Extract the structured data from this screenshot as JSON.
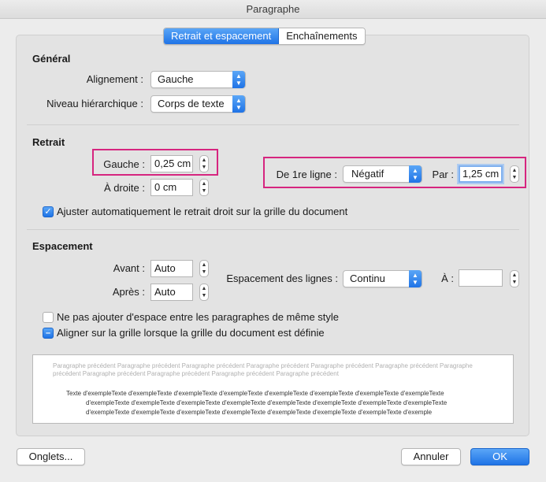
{
  "window": {
    "title": "Paragraphe"
  },
  "tabs": [
    {
      "label": "Retrait et espacement",
      "active": true
    },
    {
      "label": "Enchaînements",
      "active": false
    }
  ],
  "general": {
    "title": "Général",
    "alignment_label": "Alignement :",
    "alignment_value": "Gauche",
    "level_label": "Niveau hiérarchique :",
    "level_value": "Corps de texte"
  },
  "indent": {
    "title": "Retrait",
    "left_label": "Gauche :",
    "left_value": "0,25 cm",
    "right_label": "À droite :",
    "right_value": "0 cm",
    "first_line_label": "De 1re ligne :",
    "first_line_value": "Négatif",
    "by_label": "Par :",
    "by_value": "1,25 cm",
    "auto_adjust_label": "Ajuster automatiquement le retrait droit sur la grille du document",
    "auto_adjust_checked": true
  },
  "spacing": {
    "title": "Espacement",
    "before_label": "Avant :",
    "before_value": "Auto",
    "after_label": "Après :",
    "after_value": "Auto",
    "line_spacing_label": "Espacement des lignes :",
    "line_spacing_value": "Continu",
    "at_label": "À :",
    "at_value": "",
    "no_space_label": "Ne pas ajouter d'espace entre les paragraphes de même style",
    "no_space_checked": false,
    "snap_grid_label": "Aligner sur la grille lorsque la grille du document est définie",
    "snap_grid_state": "mixed"
  },
  "preview": {
    "previous_lines": [
      "Paragraphe précédent Paragraphe précédent Paragraphe précédent Paragraphe précédent Paragraphe précédent Paragraphe précédent Paragraphe",
      "précédent Paragraphe précédent Paragraphe précédent Paragraphe précédent Paragraphe précédent"
    ],
    "example_lines": [
      "Texte d'exempleTexte d'exempleTexte d'exempleTexte d'exempleTexte d'exempleTexte d'exempleTexte d'exempleTexte d'exempleTexte",
      "d'exempleTexte d'exempleTexte d'exempleTexte d'exempleTexte d'exempleTexte d'exempleTexte d'exempleTexte d'exempleTexte",
      "d'exempleTexte d'exempleTexte d'exempleTexte d'exempleTexte d'exempleTexte d'exempleTexte d'exempleTexte d'exemple"
    ]
  },
  "buttons": {
    "tabs": "Onglets...",
    "cancel": "Annuler",
    "ok": "OK"
  },
  "colors": {
    "accent": "#1f73e6",
    "highlight": "#d6257f"
  }
}
